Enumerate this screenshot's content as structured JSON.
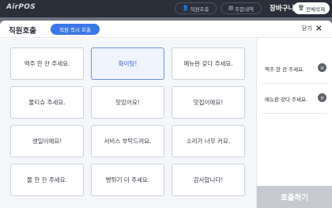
{
  "topbar": {
    "logo": "AirPOS",
    "staff_call_label": "직원호출",
    "orders_label": "주문내역",
    "cart_label": "장바구니",
    "clear_label": "전체삭제"
  },
  "modal": {
    "title": "직원호출",
    "call_now_label": "직원 즉시 호출",
    "close_label": "닫기",
    "close_icon": "×"
  },
  "tiles": [
    "맥주 한 잔 주세요.",
    "화이팅!",
    "메뉴판 갖다 주세요.",
    "물티슈 주세요.",
    "맛있어요!",
    "맛집이에요!",
    "생일이에요!",
    "서비스 부탁드려요.",
    "소리가 너무 커요.",
    "물 한 잔 주세요.",
    "빵튀기 더 주세요.",
    "감사합니다!"
  ],
  "selected_tile": "화이팅!",
  "selection_panel": {
    "items": [
      {
        "label": "맥주 한 잔 주세요.",
        "remove_icon": "×"
      },
      {
        "label": "메뉴판 갖다 주세요.",
        "remove_icon": "×"
      }
    ],
    "submit_label": "호출하기"
  },
  "colors": {
    "topbar_bg": "#2b2f3a",
    "accent_blue": "#3a78e6",
    "submit_disabled": "#c6c9cf"
  }
}
